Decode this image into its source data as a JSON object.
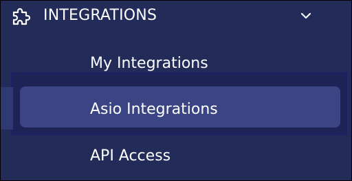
{
  "section": {
    "label": "INTEGRATIONS",
    "icon": "puzzle-piece-icon",
    "toggle_icon": "chevron-down-icon"
  },
  "nav": {
    "items": [
      {
        "label": "My Integrations",
        "selected": false
      },
      {
        "label": "Asio Integrations",
        "selected": true
      },
      {
        "label": "API Access",
        "selected": false
      }
    ]
  },
  "colors": {
    "background": "#232b59",
    "selected_background": "#3b4584",
    "selection_outline": "#1b2260",
    "text": "#ffffff"
  }
}
